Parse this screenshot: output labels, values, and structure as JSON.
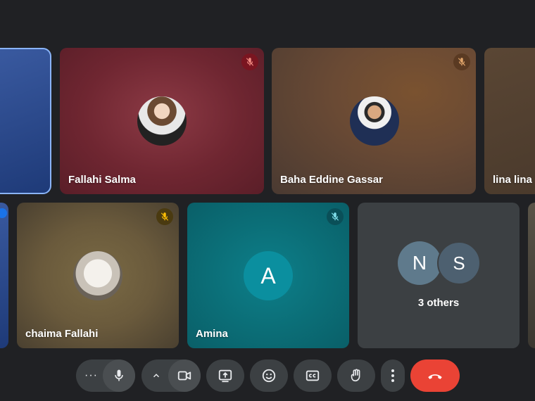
{
  "participants": {
    "salma": {
      "name": "Fallahi Salma",
      "muted": true
    },
    "baha": {
      "name": "Baha Eddine Gassar",
      "muted": true
    },
    "lina": {
      "name": "lina lina"
    },
    "chaima": {
      "name": "chaima Fallahi",
      "muted": true
    },
    "amina": {
      "name": "Amina",
      "initial": "A",
      "muted": true
    },
    "others": {
      "initial_1": "N",
      "initial_2": "S",
      "label": "3 others"
    }
  },
  "controls": {
    "items": [
      "more-options",
      "microphone",
      "camera-options",
      "camera",
      "present-screen",
      "reactions",
      "captions",
      "raise-hand",
      "more-vert",
      "leave-call"
    ],
    "leave_color": "#ea4335"
  },
  "colors": {
    "background": "#202124",
    "accent_border": "#8ab4f8",
    "amina_avatar": "#0b8f9f"
  }
}
